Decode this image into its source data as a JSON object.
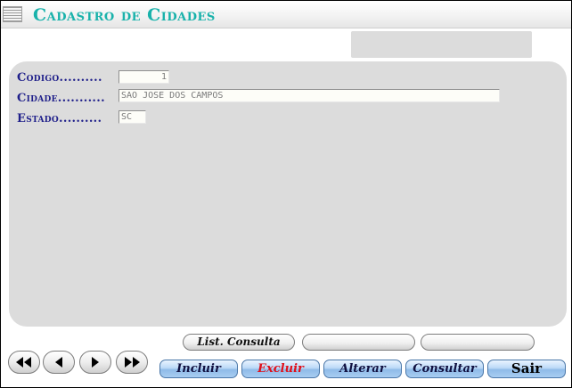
{
  "window": {
    "title": "Cadastro de Cidades",
    "status_text": ""
  },
  "form": {
    "codigo": {
      "label": "Codigo..........",
      "value": "1"
    },
    "cidade": {
      "label": "Cidade...........",
      "value": "SAO JOSE DOS CAMPOS"
    },
    "estado": {
      "label": "Estado..........",
      "value": "SC"
    }
  },
  "navigation": {
    "first_icon": "double-left-arrow-icon",
    "prev_icon": "left-arrow-icon",
    "next_icon": "right-arrow-icon",
    "last_icon": "double-right-arrow-icon"
  },
  "secondary_buttons": {
    "list_consulta": "List. Consulta",
    "blank_1": "",
    "blank_2": ""
  },
  "actions": {
    "incluir": "Incluir",
    "excluir": "Excluir",
    "alterar": "Alterar",
    "consultar": "Consultar",
    "sair": "Sair"
  },
  "colors": {
    "title": "#19b2ab",
    "labels": "#1f1f8a",
    "excluir": "#e0101a",
    "panel": "#dcdcdc",
    "action_button": "#a9cdf2"
  }
}
